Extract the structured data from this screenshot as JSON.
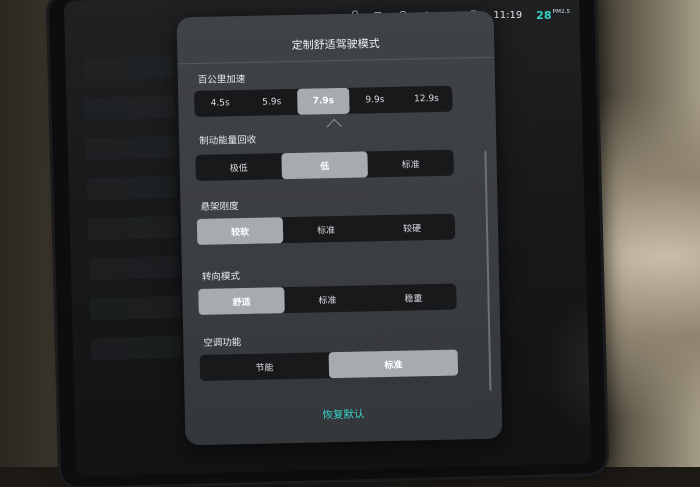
{
  "status_bar": {
    "time": "11:19",
    "temperature": "28",
    "temp_unit": "PM2.5",
    "icons": [
      "bell-icon",
      "camera-icon",
      "steering-icon",
      "bluetooth-icon",
      "signal-icon",
      "sim-icon"
    ]
  },
  "modal": {
    "title": "定制舒适驾驶模式",
    "sections": [
      {
        "label": "百公里加速",
        "options": [
          "4.5s",
          "5.9s",
          "7.9s",
          "9.9s",
          "12.9s"
        ],
        "selected": "7.9s"
      },
      {
        "label": "制动能量回收",
        "options": [
          "极低",
          "低",
          "标准"
        ],
        "selected": "低"
      },
      {
        "label": "悬架刚度",
        "options": [
          "较软",
          "标准",
          "较硬"
        ],
        "selected": "较软"
      },
      {
        "label": "转向模式",
        "options": [
          "舒适",
          "标准",
          "稳重"
        ],
        "selected": "舒适"
      },
      {
        "label": "空调功能",
        "options": [
          "节能",
          "标准"
        ],
        "selected": "标准"
      }
    ],
    "reset_label": "恢复默认"
  },
  "colors": {
    "accent": "#38d0c8",
    "segment_bg": "#18191b",
    "segment_active": "#a6abb0",
    "modal_bg": "#3d4044"
  }
}
